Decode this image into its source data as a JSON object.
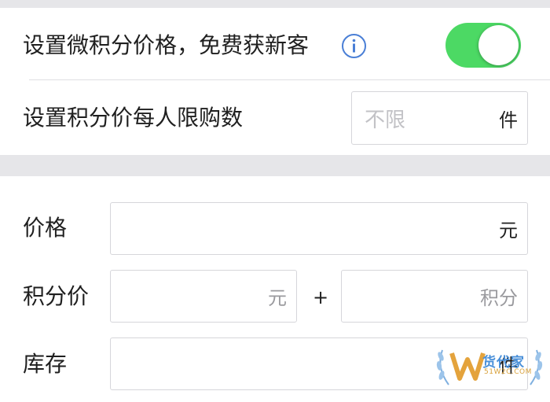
{
  "settings": {
    "micro_points_label": "设置微积分价格，免费获新客",
    "micro_points_enabled": true,
    "limit_label": "设置积分价每人限购数",
    "limit_placeholder": "不限",
    "limit_unit": "件"
  },
  "form": {
    "price_label": "价格",
    "price_unit": "元",
    "points_price_label": "积分价",
    "points_price_cash_unit": "元",
    "plus_sign": "+",
    "points_price_points_unit": "积分",
    "stock_label": "库存",
    "stock_unit": "件"
  },
  "watermark": {
    "text": "货代家",
    "sub": "51W2C.COM"
  },
  "colors": {
    "toggle_on": "#4cd964",
    "info_icon": "#4a7fd6",
    "section_band": "#e6e6e9"
  },
  "icons": {
    "info": "info-circle-icon",
    "watermark_logo": "laurel-w-logo"
  }
}
